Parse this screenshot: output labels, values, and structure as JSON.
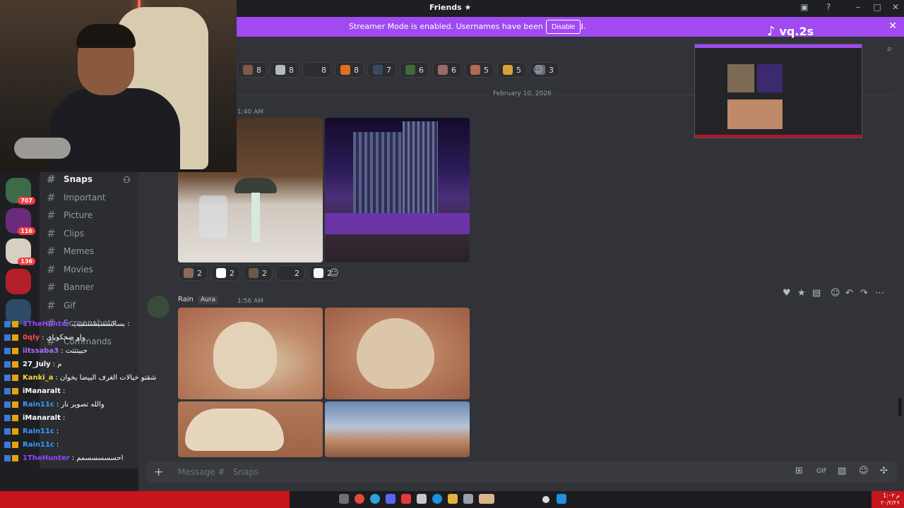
{
  "window": {
    "title": "Friends ★"
  },
  "streamer_banner": {
    "message": "Streamer Mode is enabled. Usernames have been truncated.",
    "disable_label": "Disable"
  },
  "overlay": {
    "tiktok_handle": "vq.2s"
  },
  "servers": [
    {
      "badge": "707",
      "color": "#3d6b4a"
    },
    {
      "badge": "116",
      "color": "#6a2b7a"
    },
    {
      "badge": "136",
      "color": "#d6d0c4"
    },
    {
      "badge": "",
      "color": "#b3202a"
    },
    {
      "badge": "",
      "color": "#2e4a66"
    }
  ],
  "channels": [
    {
      "name": "Snaps",
      "active": true
    },
    {
      "name": "Important"
    },
    {
      "name": "Picture"
    },
    {
      "name": "Clips"
    },
    {
      "name": "Memes"
    },
    {
      "name": "Movies"
    },
    {
      "name": "Banner"
    },
    {
      "name": "Gif"
    },
    {
      "name": "Screenshots"
    },
    {
      "name": "Commands"
    }
  ],
  "reactions_top": [
    {
      "count": "8",
      "color": "#7d5a4a"
    },
    {
      "count": "8",
      "color": "#b5bac1"
    },
    {
      "count": "8",
      "color": "#2b2d31"
    },
    {
      "count": "8",
      "color": "#e0701e"
    },
    {
      "count": "7",
      "color": "#3b4a5c"
    },
    {
      "count": "6",
      "color": "#3d6b3a"
    },
    {
      "count": "6",
      "color": "#9a6b6b"
    },
    {
      "count": "5",
      "color": "#b06a52"
    },
    {
      "count": "5",
      "color": "#d6a23a"
    },
    {
      "count": "3",
      "color": "#6a6f78"
    }
  ],
  "date_separator": "February 10, 2026",
  "message1": {
    "time": "1:40 AM"
  },
  "reactions_mid": [
    {
      "count": "2",
      "color": "#8a6a5a"
    },
    {
      "count": "2",
      "color": "#ffffff"
    },
    {
      "count": "2",
      "color": "#6a5a4a"
    },
    {
      "count": "2",
      "color": "#2b2d31"
    },
    {
      "count": "2",
      "color": "#f5f5f5"
    }
  ],
  "message2": {
    "author": "Rain",
    "tag": "Aura",
    "time": "1:56 AM"
  },
  "composer": {
    "placeholder": "Message # · Snaps"
  },
  "chat": [
    {
      "user": "1TheHunter",
      "color": "#9146ff",
      "text": "بسالسسبشسنببب :"
    },
    {
      "user": "0qly",
      "color": "#ff4a4a",
      "text": ": واو ضحكوباي"
    },
    {
      "user": "iitssaba3",
      "color": "#a970ff",
      "text": ": حبيتتتت"
    },
    {
      "user": "27_July",
      "color": "#ffffff",
      "text": ": م"
    },
    {
      "user": "Kanki_a",
      "color": "#ffd23f",
      "text": ": شقتو خيالات الغرف البيضا يخوان"
    },
    {
      "user": "iManaralt",
      "color": "#ffffff",
      "text": ":"
    },
    {
      "user": "Rain11c",
      "color": "#3a9bff",
      "text": ": والله تصوير نار"
    },
    {
      "user": "iManaralt",
      "color": "#ffffff",
      "text": ":"
    },
    {
      "user": "Rain11c",
      "color": "#3a9bff",
      "text": ":"
    },
    {
      "user": "Rain11c",
      "color": "#3a9bff",
      "text": ":"
    },
    {
      "user": "1TheHunter",
      "color": "#9146ff",
      "text": ": احسسسسسمم"
    }
  ],
  "taskbar": {
    "time": "1:۰۳ م",
    "date": "۲۰/۲/۲۶"
  }
}
